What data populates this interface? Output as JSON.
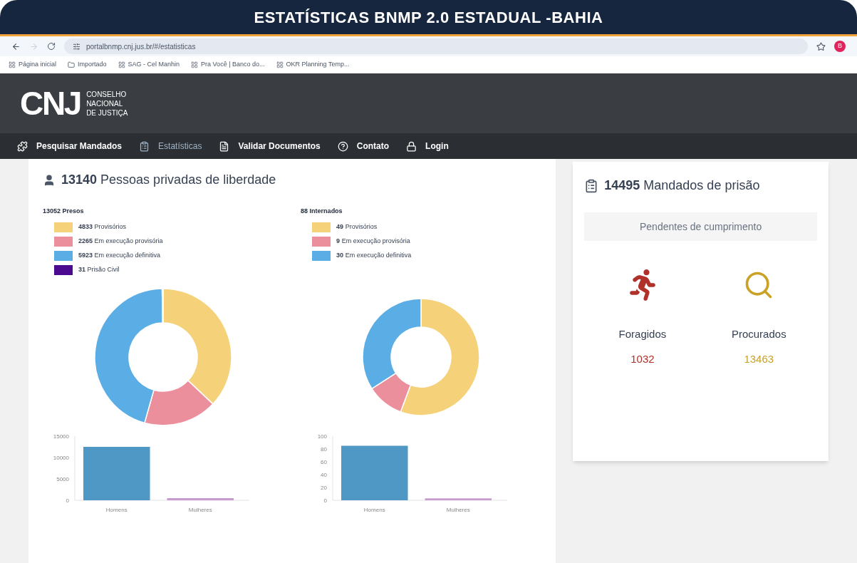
{
  "banner": {
    "title": "ESTATÍSTICAS BNMP 2.0 ESTADUAL -BAHIA"
  },
  "browser": {
    "url": "portalbnmp.cnj.jus.br/#/estatisticas",
    "profile": "B",
    "bookmarks": [
      {
        "label": "Página inicial"
      },
      {
        "label": "Importado"
      },
      {
        "label": "SAG - Cel Manhin"
      },
      {
        "label": "Pra Você | Banco do..."
      },
      {
        "label": "OKR Planning Temp..."
      }
    ]
  },
  "header": {
    "logo": "CNJ",
    "org_lines": [
      "CONSELHO",
      "NACIONAL",
      "DE JUSTIÇA"
    ]
  },
  "nav": [
    {
      "label": "Pesquisar Mandados",
      "selected": false
    },
    {
      "label": "Estatísticas",
      "selected": true
    },
    {
      "label": "Validar Documentos",
      "selected": false
    },
    {
      "label": "Contato",
      "selected": false
    },
    {
      "label": "Login",
      "selected": false
    }
  ],
  "people": {
    "count": "13140",
    "title": "Pessoas privadas de liberdade",
    "groups": [
      {
        "heading": "13052 Presos",
        "legend": [
          {
            "count": "4833",
            "label": "Provisórios",
            "color": "#f5d27a"
          },
          {
            "count": "2265",
            "label": "Em execução provisória",
            "color": "#ec8f9c"
          },
          {
            "count": "5923",
            "label": "Em execução definitiva",
            "color": "#5aaee5"
          },
          {
            "count": "31",
            "label": "Prisão Civil",
            "color": "#4b0a8f"
          }
        ],
        "donut": {
          "chart_data": {
            "type": "donut",
            "values": [
              37.03,
              17.35,
              45.38,
              0.24
            ]
          }
        },
        "bars": {
          "chart_data": {
            "type": "bar",
            "categories": [
              "Homens",
              "Mulheres"
            ],
            "values": [
              12500,
              500
            ],
            "ylim": [
              0,
              15000
            ],
            "yticks": [
              0,
              5000,
              10000,
              15000
            ]
          }
        }
      },
      {
        "heading": "88 Internados",
        "legend": [
          {
            "count": "49",
            "label": "Provisórios",
            "color": "#f5d27a"
          },
          {
            "count": "9",
            "label": "Em execução provisória",
            "color": "#ec8f9c"
          },
          {
            "count": "30",
            "label": "Em execução definitiva",
            "color": "#5aaee5"
          }
        ],
        "donut": {
          "chart_data": {
            "type": "donut",
            "values": [
              55.68,
              10.23,
              34.09
            ]
          }
        },
        "bars": {
          "chart_data": {
            "type": "bar",
            "categories": [
              "Homens",
              "Mulheres"
            ],
            "values": [
              85,
              3
            ],
            "ylim": [
              0,
              100
            ],
            "yticks": [
              0,
              20,
              40,
              60,
              80,
              100
            ]
          }
        }
      }
    ]
  },
  "warrants": {
    "count": "14495",
    "title": "Mandados de prisão",
    "subtitle": "Pendentes de cumprimento",
    "stats": [
      {
        "kind": "runner",
        "label": "Foragidos",
        "value": "1032",
        "color": "#b0302a"
      },
      {
        "kind": "search",
        "label": "Procurados",
        "value": "13463",
        "color": "#c9a227"
      }
    ]
  }
}
